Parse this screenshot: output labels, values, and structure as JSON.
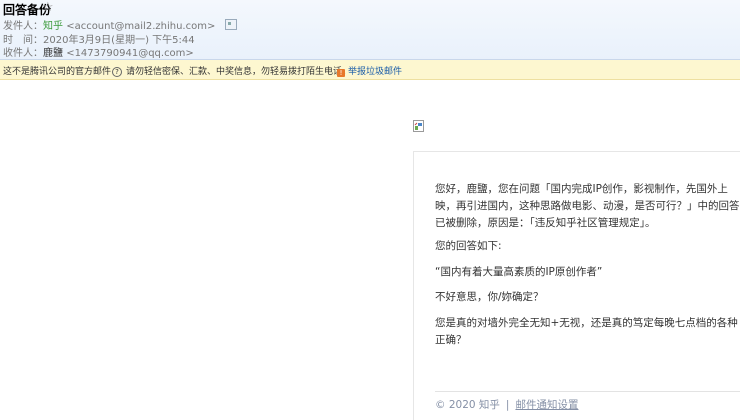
{
  "header": {
    "subject": "回答备份",
    "sender_label": "发件人：",
    "sender_name": "知乎",
    "sender_address": "<account@mail2.zhihu.com>",
    "time_label": "时　间：",
    "time_value": "2020年3月9日(星期一) 下午5:44",
    "recipient_label": "收件人：",
    "recipient_name": "鹿鹽",
    "recipient_address": "<1473790941@qq.com>"
  },
  "warning": {
    "notice": "这不是腾讯公司的官方邮件",
    "help": "?",
    "tip": "请勿轻信密保、汇款、中奖信息，勿轻易拨打陌生电话。",
    "report": "举报垃圾邮件"
  },
  "body": {
    "paragraph1": "您好，鹿鹽，您在问题「国内完成IP创作，影视制作，先国外上映，再引进国内，这种思路做电影、动漫，是否可行？」中的回答已被删除，原因是：「违反知乎社区管理规定」。",
    "paragraph2": "您的回答如下:",
    "paragraph3": "“国内有着大量高素质的IP原创作者”",
    "paragraph4": "不好意思，你/妳确定？",
    "paragraph5": "您是真的对墙外完全无知+无视，还是真的笃定每晚七点档的各种正确？"
  },
  "footer": {
    "copyright": "© 2020 知乎",
    "separator": "|",
    "settings_link": "邮件通知设置"
  }
}
